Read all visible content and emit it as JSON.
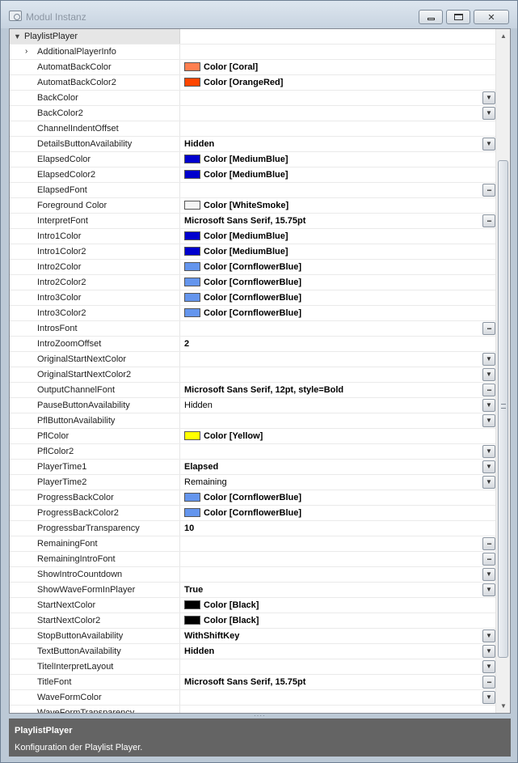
{
  "window": {
    "title": "Modul Instanz",
    "buttons": {
      "minimize": "",
      "maximize": "",
      "close": "✕"
    }
  },
  "property_grid": {
    "category": "PlaylistPlayer",
    "rows": [
      {
        "name": "AdditionalPlayerInfo",
        "value": "",
        "expandable": true
      },
      {
        "name": "AutomatBackColor",
        "value": "Color [Coral]",
        "swatch": "#ff7f50",
        "bold": true
      },
      {
        "name": "AutomatBackColor2",
        "value": "Color [OrangeRed]",
        "swatch": "#ff4500",
        "bold": true
      },
      {
        "name": "BackColor",
        "value": "",
        "button": "dropdown"
      },
      {
        "name": "BackColor2",
        "value": "",
        "button": "dropdown"
      },
      {
        "name": "ChannelIndentOffset",
        "value": ""
      },
      {
        "name": "DetailsButtonAvailability",
        "value": "Hidden",
        "bold": true,
        "button": "dropdown"
      },
      {
        "name": "ElapsedColor",
        "value": "Color [MediumBlue]",
        "swatch": "#0000cd",
        "bold": true
      },
      {
        "name": "ElapsedColor2",
        "value": "Color [MediumBlue]",
        "swatch": "#0000cd",
        "bold": true
      },
      {
        "name": "ElapsedFont",
        "value": "",
        "button": "ellipsis"
      },
      {
        "name": "Foreground Color",
        "value": "Color [WhiteSmoke]",
        "swatch": "#f5f5f5",
        "bold": true
      },
      {
        "name": "InterpretFont",
        "value": "Microsoft Sans Serif, 15.75pt",
        "bold": true,
        "button": "ellipsis"
      },
      {
        "name": "Intro1Color",
        "value": "Color [MediumBlue]",
        "swatch": "#0000cd",
        "bold": true
      },
      {
        "name": "Intro1Color2",
        "value": "Color [MediumBlue]",
        "swatch": "#0000cd",
        "bold": true
      },
      {
        "name": "Intro2Color",
        "value": "Color [CornflowerBlue]",
        "swatch": "#6495ed",
        "bold": true
      },
      {
        "name": "Intro2Color2",
        "value": "Color [CornflowerBlue]",
        "swatch": "#6495ed",
        "bold": true
      },
      {
        "name": "Intro3Color",
        "value": "Color [CornflowerBlue]",
        "swatch": "#6495ed",
        "bold": true
      },
      {
        "name": "Intro3Color2",
        "value": "Color [CornflowerBlue]",
        "swatch": "#6495ed",
        "bold": true
      },
      {
        "name": "IntrosFont",
        "value": "",
        "button": "ellipsis"
      },
      {
        "name": "IntroZoomOffset",
        "value": "2",
        "bold": true
      },
      {
        "name": "OriginalStartNextColor",
        "value": "",
        "button": "dropdown"
      },
      {
        "name": "OriginalStartNextColor2",
        "value": "",
        "button": "dropdown"
      },
      {
        "name": "OutputChannelFont",
        "value": "Microsoft Sans Serif, 12pt, style=Bold",
        "bold": true,
        "button": "ellipsis"
      },
      {
        "name": "PauseButtonAvailability",
        "value": "Hidden",
        "button": "dropdown"
      },
      {
        "name": "PflButtonAvailability",
        "value": "",
        "button": "dropdown"
      },
      {
        "name": "PflColor",
        "value": "Color [Yellow]",
        "swatch": "#ffff00",
        "bold": true
      },
      {
        "name": "PflColor2",
        "value": "",
        "button": "dropdown"
      },
      {
        "name": "PlayerTime1",
        "value": "Elapsed",
        "bold": true,
        "button": "dropdown"
      },
      {
        "name": "PlayerTime2",
        "value": "Remaining",
        "button": "dropdown"
      },
      {
        "name": "ProgressBackColor",
        "value": "Color [CornflowerBlue]",
        "swatch": "#6495ed",
        "bold": true
      },
      {
        "name": "ProgressBackColor2",
        "value": "Color [CornflowerBlue]",
        "swatch": "#6495ed",
        "bold": true
      },
      {
        "name": "ProgressbarTransparency",
        "value": "10",
        "bold": true
      },
      {
        "name": "RemainingFont",
        "value": "",
        "button": "ellipsis"
      },
      {
        "name": "RemainingIntroFont",
        "value": "",
        "button": "ellipsis"
      },
      {
        "name": "ShowIntroCountdown",
        "value": "",
        "button": "dropdown"
      },
      {
        "name": "ShowWaveFormInPlayer",
        "value": "True",
        "bold": true,
        "button": "dropdown"
      },
      {
        "name": "StartNextColor",
        "value": "Color [Black]",
        "swatch": "#000000",
        "bold": true
      },
      {
        "name": "StartNextColor2",
        "value": "Color [Black]",
        "swatch": "#000000",
        "bold": true
      },
      {
        "name": "StopButtonAvailability",
        "value": "WithShiftKey",
        "bold": true,
        "button": "dropdown"
      },
      {
        "name": "TextButtonAvailability",
        "value": "Hidden",
        "bold": true,
        "button": "dropdown"
      },
      {
        "name": "TitelInterpretLayout",
        "value": "",
        "button": "dropdown"
      },
      {
        "name": "TitleFont",
        "value": "Microsoft Sans Serif, 15.75pt",
        "bold": true,
        "button": "ellipsis"
      },
      {
        "name": "WaveFormColor",
        "value": "",
        "button": "dropdown"
      },
      {
        "name": "WaveFormTransparency",
        "value": ""
      }
    ]
  },
  "description": {
    "title": "PlaylistPlayer",
    "text": "Konfiguration der Playlist Player."
  },
  "colors": {
    "window_bg": "#bcc9d6",
    "description_bg": "#646464",
    "category_bg": "#e6e6e6"
  }
}
